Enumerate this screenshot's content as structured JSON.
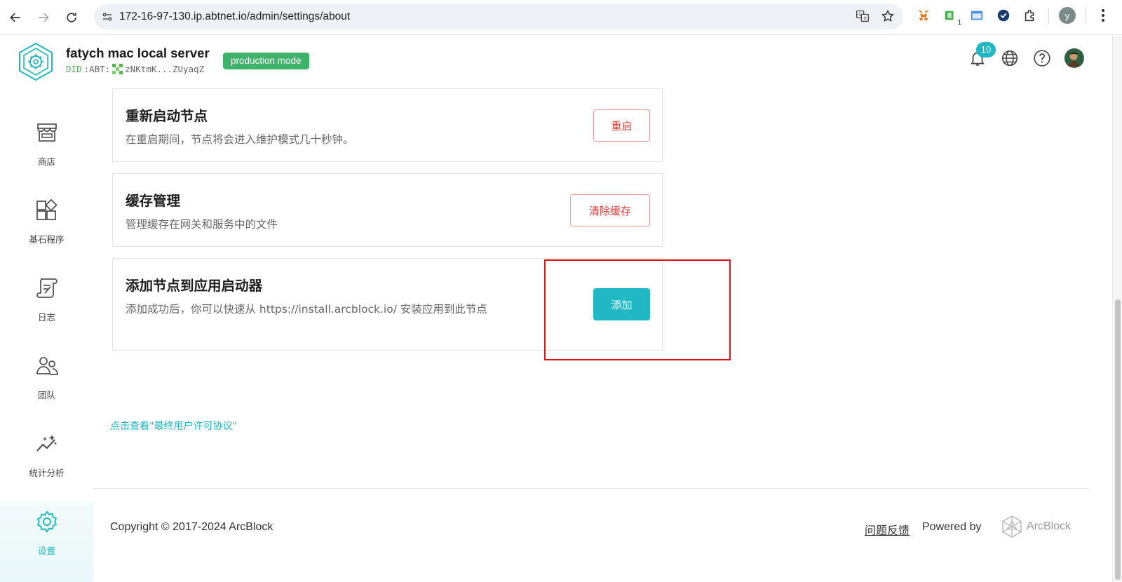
{
  "browser": {
    "url": "172-16-97-130.ip.abtnet.io/admin/settings/about",
    "profile_initial": "y",
    "extension_badge": "1"
  },
  "header": {
    "server_name": "fatych mac local server",
    "did_prefix": "DID",
    "did_chain": ":ABT:",
    "did_value": "zNKtmK...ZUyaqZ",
    "mode_badge": "production mode",
    "notification_count": "10"
  },
  "sidebar": {
    "items": [
      {
        "label": "商店",
        "icon": "store-icon"
      },
      {
        "label": "基石程序",
        "icon": "blocklet-icon"
      },
      {
        "label": "日志",
        "icon": "log-icon"
      },
      {
        "label": "团队",
        "icon": "team-icon"
      },
      {
        "label": "统计分析",
        "icon": "analytics-icon"
      },
      {
        "label": "设置",
        "icon": "settings-icon",
        "active": true
      }
    ]
  },
  "cards": {
    "restart": {
      "title": "重新启动节点",
      "desc": "在重启期间，节点将会进入维护模式几十秒钟。",
      "button": "重启"
    },
    "cache": {
      "title": "缓存管理",
      "desc": "管理缓存在网关和服务中的文件",
      "button": "清除缓存"
    },
    "launcher": {
      "title": "添加节点到应用启动器",
      "desc": "添加成功后，你可以快速从 https://install.arcblock.io/ 安装应用到此节点",
      "button": "添加"
    }
  },
  "eula_link": "点击查看\"最终用户许可协议\"",
  "footer": {
    "copyright": "Copyright © 2017-2024  ArcBlock",
    "feedback": "问题反馈",
    "powered_by": "Powered by",
    "brand": "ArcBlock"
  },
  "colors": {
    "accent": "#1fb8c4",
    "danger": "#e53935",
    "badge_green": "#3fb36a",
    "highlight_red": "#e01010"
  }
}
